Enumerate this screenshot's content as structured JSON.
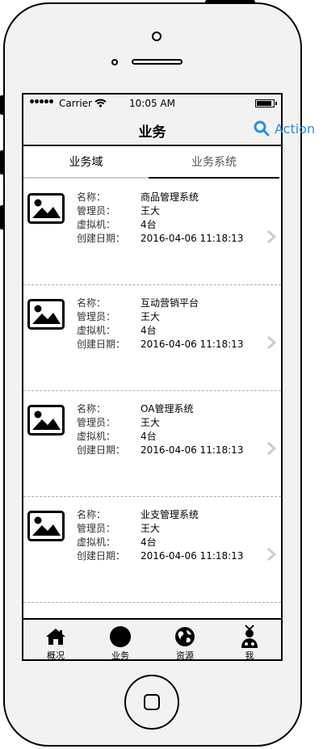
{
  "status_bar": {
    "carrier": "Carrier",
    "time": "10:05 AM"
  },
  "nav": {
    "title": "业务",
    "action_label": "Action"
  },
  "tabs": [
    {
      "label": "业务域",
      "active": false
    },
    {
      "label": "业务系统",
      "active": true
    }
  ],
  "field_labels": {
    "name": "名称：",
    "manager": "管理员：",
    "vm": "虚拟机：",
    "created": "创建日期："
  },
  "items": [
    {
      "name": "商品管理系统",
      "manager": "王大",
      "vm": "4台",
      "created": "2016-04-06 11:18:13"
    },
    {
      "name": "互动营销平台",
      "manager": "王大",
      "vm": "4台",
      "created": "2016-04-06 11:18:13"
    },
    {
      "name": "OA管理系统",
      "manager": "王大",
      "vm": "4台",
      "created": "2016-04-06 11:18:13"
    },
    {
      "name": "业支管理系统",
      "manager": "王大",
      "vm": "4台",
      "created": "2016-04-06 11:18:13"
    }
  ],
  "tab_bar": [
    {
      "label": "概况",
      "icon": "home-icon"
    },
    {
      "label": "业务",
      "icon": "circle-icon"
    },
    {
      "label": "资源",
      "icon": "globe-icon"
    },
    {
      "label": "我",
      "icon": "doctor-icon"
    }
  ],
  "colors": {
    "action": "#2a8ee6",
    "phone_body": "#f2f2f2"
  }
}
